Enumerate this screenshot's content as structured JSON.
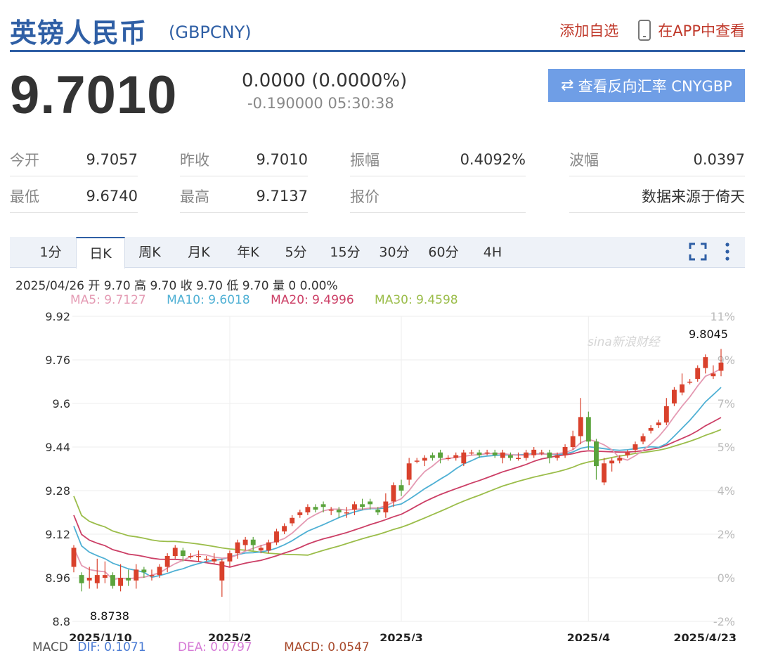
{
  "header": {
    "title": "英镑人民币",
    "code": "(GBPCNY)",
    "watch_label": "添加自选",
    "app_label": "在APP中查看"
  },
  "quote": {
    "price": "9.7010",
    "change": "0.0000 (0.0000%)",
    "sub_change": "-0.190000 05:30:38",
    "reverse_label": "查看反向汇率 CNYGBP"
  },
  "stats": {
    "open_label": "今开",
    "open_value": "9.7057",
    "prev_label": "昨收",
    "prev_value": "9.7010",
    "amp_label": "振幅",
    "amp_value": "0.4092%",
    "wave_label": "波幅",
    "wave_value": "0.0397",
    "low_label": "最低",
    "low_value": "9.6740",
    "high_label": "最高",
    "high_value": "9.7137",
    "quote_label": "报价",
    "source_text": "数据来源于倚天"
  },
  "tabs": [
    "1分",
    "日K",
    "周K",
    "月K",
    "年K",
    "5分",
    "15分",
    "30分",
    "60分",
    "4H"
  ],
  "active_tab": "日K",
  "info": {
    "ohlc_line": "2025/04/26 开 9.70 高 9.70 收 9.70 低 9.70 量 0 0.00%",
    "ma5": "MA5: 9.7127",
    "ma10": "MA10: 9.6018",
    "ma20": "MA20: 9.4996",
    "ma30": "MA30: 9.4598"
  },
  "macd": {
    "label": "MACD",
    "dif": "DIF: 0.1071",
    "dea": "DEA: 0.0797",
    "macd": "MACD: 0.0547"
  },
  "colors": {
    "brand": "#2f5fa5",
    "up": "#d9412c",
    "down": "#5aa33c",
    "ma5": "#e49ab3",
    "ma10": "#4fb0d4",
    "ma20": "#cc3f66",
    "ma30": "#9bbd4a",
    "reverse_button": "#6f9ee6"
  },
  "chart_data": {
    "type": "candlestick",
    "y_ticks": [
      "9.92",
      "9.76",
      "9.6",
      "9.44",
      "9.28",
      "9.12",
      "8.96",
      "8.8"
    ],
    "y_right_ticks": [
      "11%",
      "9%",
      "7%",
      "5%",
      "4%",
      "2%",
      "0%",
      "-2%"
    ],
    "ylim": [
      8.8,
      9.92
    ],
    "x_labels": [
      "2025/1/10",
      "2025/2",
      "2025/3",
      "2025/4",
      "2025/4/23"
    ],
    "max_label": "9.8045",
    "min_label": "8.8738",
    "watermark": "sina新浪财经",
    "candles": [
      [
        9.0,
        9.07,
        8.98,
        9.08
      ],
      [
        8.97,
        8.94,
        8.91,
        8.98
      ],
      [
        8.95,
        8.96,
        8.92,
        9.0
      ],
      [
        8.94,
        8.97,
        8.92,
        9.03
      ],
      [
        8.96,
        8.97,
        8.94,
        9.02
      ],
      [
        8.97,
        8.93,
        8.92,
        8.98
      ],
      [
        8.93,
        8.96,
        8.91,
        9.01
      ],
      [
        8.96,
        8.95,
        8.93,
        8.99
      ],
      [
        8.95,
        8.99,
        8.92,
        9.01
      ],
      [
        8.99,
        8.98,
        8.96,
        9.0
      ],
      [
        8.97,
        8.97,
        8.95,
        8.99
      ],
      [
        8.97,
        9.0,
        8.96,
        9.01
      ],
      [
        9.0,
        9.04,
        8.98,
        9.05
      ],
      [
        9.04,
        9.07,
        9.03,
        9.08
      ],
      [
        9.06,
        9.04,
        9.02,
        9.07
      ],
      [
        9.04,
        9.04,
        9.03,
        9.05
      ],
      [
        9.04,
        9.04,
        9.02,
        9.06
      ],
      [
        9.03,
        9.03,
        9.02,
        9.04
      ],
      [
        9.02,
        9.03,
        9.01,
        9.05
      ],
      [
        8.95,
        9.02,
        8.89,
        9.03
      ],
      [
        9.02,
        9.05,
        9.0,
        9.06
      ],
      [
        9.05,
        9.09,
        9.03,
        9.1
      ],
      [
        9.08,
        9.1,
        9.06,
        9.11
      ],
      [
        9.1,
        9.08,
        9.06,
        9.11
      ],
      [
        9.06,
        9.07,
        9.05,
        9.08
      ],
      [
        9.06,
        9.09,
        9.05,
        9.1
      ],
      [
        9.09,
        9.13,
        9.08,
        9.14
      ],
      [
        9.13,
        9.15,
        9.12,
        9.16
      ],
      [
        9.16,
        9.18,
        9.15,
        9.19
      ],
      [
        9.19,
        9.2,
        9.18,
        9.21
      ],
      [
        9.2,
        9.22,
        9.19,
        9.23
      ],
      [
        9.22,
        9.21,
        9.2,
        9.23
      ],
      [
        9.23,
        9.22,
        9.2,
        9.24
      ],
      [
        9.21,
        9.21,
        9.19,
        9.22
      ],
      [
        9.21,
        9.2,
        9.18,
        9.22
      ],
      [
        9.2,
        9.2,
        9.18,
        9.22
      ],
      [
        9.21,
        9.23,
        9.19,
        9.24
      ],
      [
        9.23,
        9.22,
        9.21,
        9.25
      ],
      [
        9.24,
        9.23,
        9.21,
        9.25
      ],
      [
        9.21,
        9.2,
        9.19,
        9.22
      ],
      [
        9.2,
        9.24,
        9.18,
        9.27
      ],
      [
        9.24,
        9.3,
        9.22,
        9.31
      ],
      [
        9.3,
        9.28,
        9.26,
        9.32
      ],
      [
        9.32,
        9.38,
        9.3,
        9.4
      ],
      [
        9.39,
        9.39,
        9.38,
        9.4
      ],
      [
        9.39,
        9.4,
        9.37,
        9.41
      ],
      [
        9.41,
        9.4,
        9.39,
        9.42
      ],
      [
        9.42,
        9.4,
        9.38,
        9.43
      ],
      [
        9.4,
        9.4,
        9.39,
        9.41
      ],
      [
        9.4,
        9.41,
        9.39,
        9.42
      ],
      [
        9.38,
        9.42,
        9.37,
        9.43
      ],
      [
        9.42,
        9.42,
        9.41,
        9.43
      ],
      [
        9.42,
        9.41,
        9.4,
        9.43
      ],
      [
        9.42,
        9.42,
        9.41,
        9.43
      ],
      [
        9.42,
        9.41,
        9.4,
        9.43
      ],
      [
        9.4,
        9.42,
        9.38,
        9.43
      ],
      [
        9.41,
        9.4,
        9.39,
        9.42
      ],
      [
        9.4,
        9.4,
        9.39,
        9.42
      ],
      [
        9.4,
        9.42,
        9.39,
        9.43
      ],
      [
        9.41,
        9.43,
        9.4,
        9.44
      ],
      [
        9.42,
        9.42,
        9.41,
        9.43
      ],
      [
        9.42,
        9.4,
        9.38,
        9.43
      ],
      [
        9.4,
        9.41,
        9.39,
        9.42
      ],
      [
        9.41,
        9.44,
        9.4,
        9.45
      ],
      [
        9.44,
        9.48,
        9.43,
        9.5
      ],
      [
        9.48,
        9.55,
        9.45,
        9.62
      ],
      [
        9.55,
        9.46,
        9.43,
        9.57
      ],
      [
        9.46,
        9.37,
        9.32,
        9.47
      ],
      [
        9.31,
        9.38,
        9.3,
        9.4
      ],
      [
        9.38,
        9.39,
        9.35,
        9.4
      ],
      [
        9.39,
        9.4,
        9.38,
        9.41
      ],
      [
        9.41,
        9.42,
        9.4,
        9.43
      ],
      [
        9.43,
        9.45,
        9.42,
        9.46
      ],
      [
        9.46,
        9.48,
        9.45,
        9.49
      ],
      [
        9.5,
        9.51,
        9.49,
        9.52
      ],
      [
        9.52,
        9.53,
        9.51,
        9.54
      ],
      [
        9.53,
        9.59,
        9.52,
        9.62
      ],
      [
        9.6,
        9.65,
        9.59,
        9.66
      ],
      [
        9.64,
        9.67,
        9.63,
        9.71
      ],
      [
        9.68,
        9.68,
        9.67,
        9.69
      ],
      [
        9.69,
        9.73,
        9.68,
        9.74
      ],
      [
        9.73,
        9.77,
        9.71,
        9.78
      ],
      [
        9.7,
        9.71,
        9.69,
        9.74
      ],
      [
        9.72,
        9.75,
        9.7,
        9.8
      ]
    ]
  }
}
